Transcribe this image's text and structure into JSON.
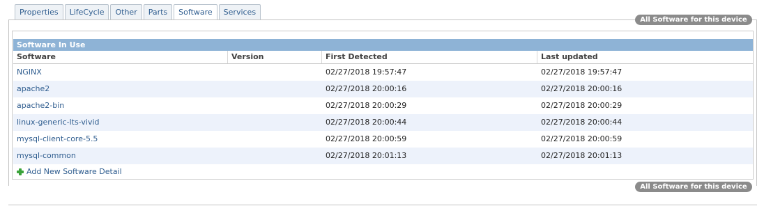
{
  "tabs": [
    {
      "label": "Properties"
    },
    {
      "label": "LifeCycle"
    },
    {
      "label": "Other"
    },
    {
      "label": "Parts"
    },
    {
      "label": "Software",
      "active": true
    },
    {
      "label": "Services"
    }
  ],
  "actions": {
    "all_software_top": "All Software for this device",
    "all_software_bottom": "All Software for this device",
    "add_new": "Add New Software Detail"
  },
  "section": {
    "title": "Software In Use",
    "columns": [
      "Software",
      "Version",
      "First Detected",
      "Last updated"
    ],
    "rows": [
      {
        "software": "NGINX",
        "version": "",
        "first_detected": "02/27/2018 19:57:47",
        "last_updated": "02/27/2018 19:57:47"
      },
      {
        "software": "apache2",
        "version": "",
        "first_detected": "02/27/2018 20:00:16",
        "last_updated": "02/27/2018 20:00:16"
      },
      {
        "software": "apache2-bin",
        "version": "",
        "first_detected": "02/27/2018 20:00:29",
        "last_updated": "02/27/2018 20:00:29"
      },
      {
        "software": "linux-generic-lts-vivid",
        "version": "",
        "first_detected": "02/27/2018 20:00:44",
        "last_updated": "02/27/2018 20:00:44"
      },
      {
        "software": "mysql-client-core-5.5",
        "version": "",
        "first_detected": "02/27/2018 20:00:59",
        "last_updated": "02/27/2018 20:00:59"
      },
      {
        "software": "mysql-common",
        "version": "",
        "first_detected": "02/27/2018 20:01:13",
        "last_updated": "02/27/2018 20:01:13"
      }
    ]
  },
  "colors": {
    "header_bar": "#8eb3d6",
    "alt_row": "#edf2fb",
    "link": "#2f5d8f",
    "pill": "#8b8b8b",
    "add_icon": "#3aa33a"
  }
}
